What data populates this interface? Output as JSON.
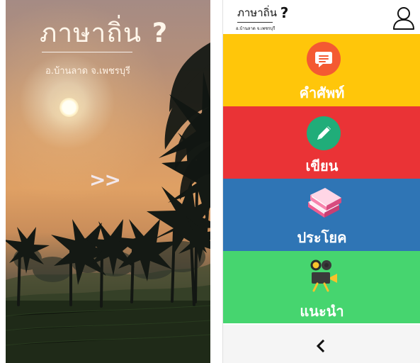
{
  "splash": {
    "title": "ภาษาถิ่น",
    "title_icon": "question-mark",
    "subtitle": "อ.บ้านลาด จ.เพชรบุรี",
    "next_label": ">>"
  },
  "app": {
    "brand": {
      "title": "ภาษาถิ่น",
      "title_icon": "question-mark",
      "subtitle": "อ.บ้านลาด จ.เพชรบุรี"
    },
    "profile_icon": "user-icon",
    "menu": [
      {
        "label": "คำศัพท์",
        "icon": "speech-bubble-icon",
        "color": "#ffc60a",
        "icon_color": "#f45a32"
      },
      {
        "label": "เขียน",
        "icon": "pencil-icon",
        "color": "#ea3336",
        "icon_color": "#20ad79"
      },
      {
        "label": "ประโยค",
        "icon": "books-icon",
        "color": "#2f75b5",
        "icon_color": "#ef5e91"
      },
      {
        "label": "แนะนำ",
        "icon": "video-camera-icon",
        "color": "#46d56f",
        "icon_color": "#3a3a3a"
      }
    ],
    "bottom_nav": {
      "back_icon": "chevron-left-icon",
      "background": "#f5f5f5"
    }
  }
}
